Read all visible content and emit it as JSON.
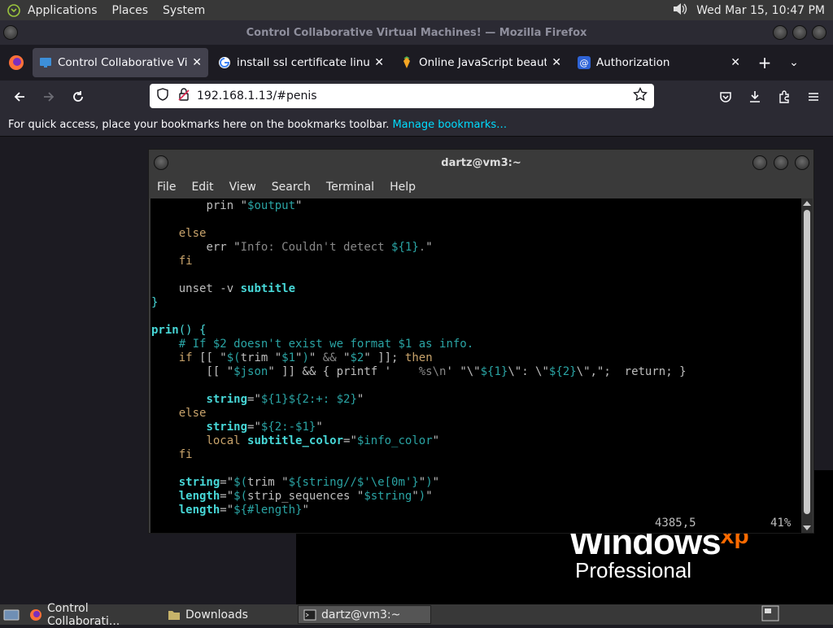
{
  "top_panel": {
    "menus": [
      "Applications",
      "Places",
      "System"
    ],
    "clock": "Wed Mar 15, 10:47 PM"
  },
  "firefox": {
    "window_title": "Control Collaborative Virtual Machines! — Mozilla Firefox",
    "tabs": [
      {
        "label": "Control Collaborative Virtual",
        "icon": "monitor-icon",
        "active": true
      },
      {
        "label": "install ssl certificate linux - G",
        "icon": "google-icon",
        "active": false
      },
      {
        "label": "Online JavaScript beautifier",
        "icon": "beautifier-icon",
        "active": false
      },
      {
        "label": "Authorization",
        "icon": "at-icon",
        "active": false
      }
    ],
    "url": "192.168.1.13/#penis",
    "bookmarks_text": "For quick access, place your bookmarks here on the bookmarks toolbar.",
    "bookmarks_link": "Manage bookmarks…"
  },
  "terminal": {
    "title": "dartz@vm3:~",
    "menus": [
      "File",
      "Edit",
      "View",
      "Search",
      "Terminal",
      "Help"
    ],
    "cursor_position": "4385,5",
    "scroll_percent": "41%"
  },
  "vm_desktop": {
    "brand": "Windows",
    "brand_suffix": "xp",
    "edition": "Professional"
  },
  "taskbar": {
    "items": [
      {
        "label": "Control Collaborati...",
        "icon": "firefox-icon"
      },
      {
        "label": "Downloads",
        "icon": "folder-icon"
      },
      {
        "label": "dartz@vm3:~",
        "icon": "terminal-icon"
      }
    ]
  },
  "colors": {
    "panel": "#383838",
    "firefox_toolbar": "#2b2a33",
    "firefox_tabstrip": "#1c1b22",
    "terminal_bg": "#000000",
    "accent_link": "#00ddff",
    "xp_orange": "#ff6a00"
  }
}
